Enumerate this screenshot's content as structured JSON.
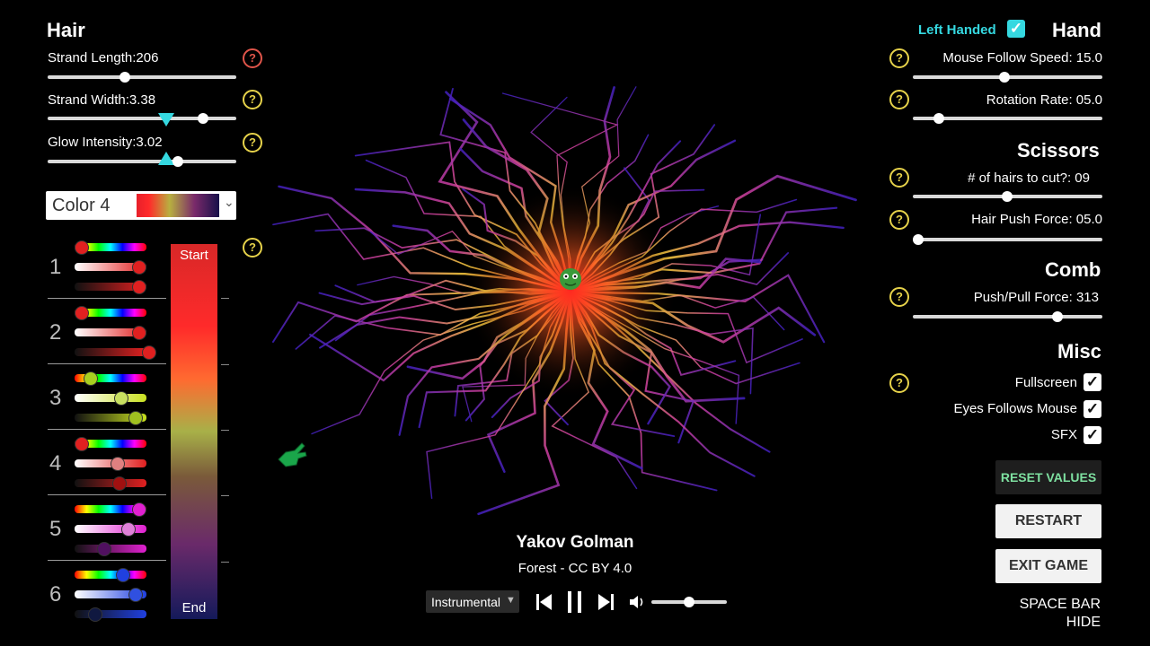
{
  "hair": {
    "title": "Hair",
    "strand_length_label": "Strand Length:",
    "strand_length_value": "206",
    "strand_width_label": "Strand Width:",
    "strand_width_value": "3.38",
    "glow_label": "Glow Intensity:",
    "glow_value": "3.02",
    "help": "?"
  },
  "color_select": {
    "label": "Color 4",
    "chevron": "⌄"
  },
  "gradient": {
    "start": "Start",
    "end": "End"
  },
  "color_rows": [
    {
      "num": "1"
    },
    {
      "num": "2"
    },
    {
      "num": "3"
    },
    {
      "num": "4"
    },
    {
      "num": "5"
    },
    {
      "num": "6"
    }
  ],
  "music": {
    "artist": "Yakov Golman",
    "track": "Forest - CC BY 4.0",
    "mode": "Instrumental"
  },
  "hand": {
    "left_handed_label": "Left Handed",
    "title": "Hand",
    "mouse_follow_label": "Mouse Follow Speed: 15.0",
    "rotation_label": "Rotation Rate: 05.0"
  },
  "scissors": {
    "title": "Scissors",
    "hairs_to_cut_label": "# of hairs to cut?: 09",
    "push_force_label": "Hair Push Force: 05.0"
  },
  "comb": {
    "title": "Comb",
    "push_pull_label": "Push/Pull Force: 313"
  },
  "misc": {
    "title": "Misc",
    "fullscreen": "Fullscreen",
    "eyes": "Eyes Follows Mouse",
    "sfx": "SFX"
  },
  "buttons": {
    "reset": "RESET VALUES",
    "restart": "RESTART",
    "exit": "EXIT GAME"
  },
  "hint": {
    "line1": "SPACE BAR",
    "line2": "HIDE"
  },
  "colors": {
    "accent_cyan": "#35d8e0",
    "reset_green": "#7ee0a0",
    "help_yellow": "#e6d24a"
  }
}
